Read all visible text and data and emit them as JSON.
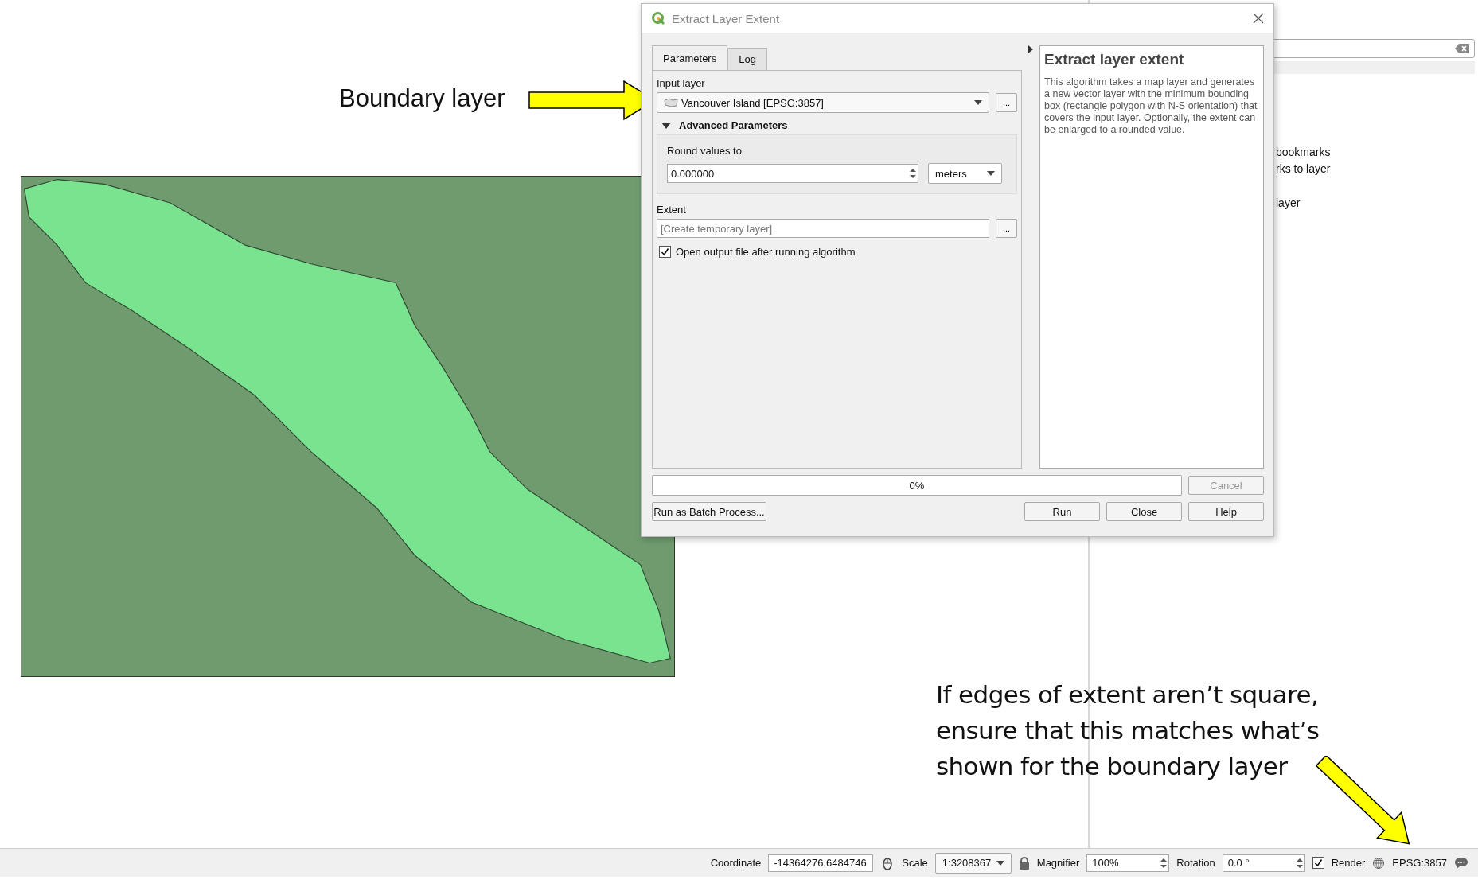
{
  "annotations": [
    {
      "kind": "callout",
      "text": "Boundary layer"
    },
    {
      "kind": "note",
      "lines": [
        "If edges of extent aren’t square,",
        "ensure that this matches what’s",
        "shown for the boundary layer"
      ]
    }
  ],
  "right_panel": {
    "items": [
      "bookmarks",
      "rks to layer",
      "layer"
    ]
  },
  "dialog": {
    "title": "Extract Layer Extent",
    "tabs": [
      {
        "label": "Parameters",
        "selected": true
      },
      {
        "label": "Log",
        "selected": false
      }
    ],
    "input_layer": {
      "label": "Input layer",
      "value": "Vancouver Island [EPSG:3857]",
      "browse": "..."
    },
    "advanced": {
      "label": "Advanced Parameters",
      "expanded": true
    },
    "round_values": {
      "label": "Round values to",
      "value": "0.000000",
      "unit": "meters"
    },
    "extent": {
      "label": "Extent",
      "placeholder": "[Create temporary layer]",
      "browse": "..."
    },
    "open_output": {
      "label": "Open output file after running algorithm",
      "checked": true
    },
    "help": {
      "title": "Extract layer extent",
      "text": "This algorithm takes a map layer and generates a new vector layer with the minimum bounding box (rectangle polygon with N-S orientation) that covers the input layer. Optionally, the extent can be enlarged to a rounded value."
    },
    "progress": {
      "text": "0%"
    },
    "cancel": {
      "label": "Cancel",
      "disabled": true
    },
    "batch": {
      "label": "Run as Batch Process..."
    },
    "buttons": [
      {
        "label": "Run"
      },
      {
        "label": "Close"
      },
      {
        "label": "Help"
      }
    ]
  },
  "status_bar": {
    "coordinate": {
      "label": "Coordinate",
      "value": "-14364276,6484746"
    },
    "scale": {
      "label": "Scale",
      "value": "1:3208367"
    },
    "magnifier": {
      "label": "Magnifier",
      "value": "100%"
    },
    "rotation": {
      "label": "Rotation",
      "value": "0.0 °"
    },
    "render": {
      "label": "Render",
      "checked": true
    },
    "crs": "EPSG:3857"
  }
}
